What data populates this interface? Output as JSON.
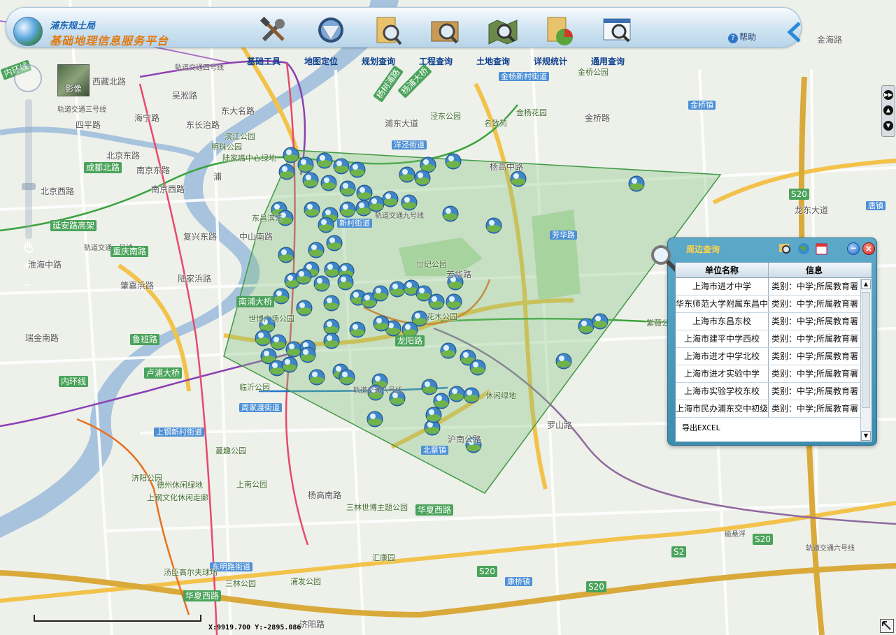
{
  "header": {
    "org_name": "浦东规土局",
    "platform_name": "基础地理信息服务平台",
    "help_label": "帮助",
    "tools": [
      {
        "label": "基础工具",
        "icon": "tools-icon"
      },
      {
        "label": "地图定位",
        "icon": "globe-locate-icon"
      },
      {
        "label": "规划查询",
        "icon": "plan-query-icon"
      },
      {
        "label": "工程查询",
        "icon": "project-query-icon"
      },
      {
        "label": "土地查询",
        "icon": "land-query-icon"
      },
      {
        "label": "详规统计",
        "icon": "pie-chart-icon"
      },
      {
        "label": "通用查询",
        "icon": "general-query-icon"
      }
    ]
  },
  "map": {
    "imagery_label": "影像",
    "labels": [
      {
        "t": "内环线",
        "c": "roadg",
        "rot": -20
      },
      {
        "t": "轨道交通四号线",
        "c": "metro"
      },
      {
        "t": "杨树浦路",
        "c": "roadg",
        "rot": -55
      },
      {
        "t": "杨浦大桥",
        "c": "roadg",
        "rot": -45
      },
      {
        "t": "金杨新村街道",
        "c": "street"
      },
      {
        "t": "金桥公园",
        "c": "poi"
      },
      {
        "t": "金桥镇",
        "c": "street"
      },
      {
        "t": "金海路",
        "c": "road"
      },
      {
        "t": "西藏北路",
        "c": "road"
      },
      {
        "t": "吴淞路",
        "c": "road"
      },
      {
        "t": "东大名路",
        "c": "road"
      },
      {
        "t": "轨道交通三号线",
        "c": "metro"
      },
      {
        "t": "四平路",
        "c": "road"
      },
      {
        "t": "海宁路",
        "c": "road"
      },
      {
        "t": "东长治路",
        "c": "road"
      },
      {
        "t": "浦东大道",
        "c": "road"
      },
      {
        "t": "泾东公园",
        "c": "poi"
      },
      {
        "t": "金杨花园",
        "c": "poi"
      },
      {
        "t": "名致苑",
        "c": "poi"
      },
      {
        "t": "杨高中路",
        "c": "road"
      },
      {
        "t": "金桥路",
        "c": "road"
      },
      {
        "t": "滨江公园",
        "c": "poi"
      },
      {
        "t": "明珠公园",
        "c": "poi"
      },
      {
        "t": "陆家嘴中心绿地",
        "c": "poi"
      },
      {
        "t": "洋泾街道",
        "c": "street"
      },
      {
        "t": "北京东路",
        "c": "road"
      },
      {
        "t": "南京东路",
        "c": "road"
      },
      {
        "t": "北京西路",
        "c": "road"
      },
      {
        "t": "成都北路",
        "c": "roadg"
      },
      {
        "t": "南京西路",
        "c": "road"
      },
      {
        "t": "浦",
        "c": "road"
      },
      {
        "t": "东昌滨江",
        "c": "poi"
      },
      {
        "t": "新村街道",
        "c": "street"
      },
      {
        "t": "轨道交通九号线",
        "c": "metro"
      },
      {
        "t": "延安路高架",
        "c": "roadg"
      },
      {
        "t": "复兴东路",
        "c": "road"
      },
      {
        "t": "中山南路",
        "c": "road"
      },
      {
        "t": "轨道交通一号线",
        "c": "metro"
      },
      {
        "t": "淮海中路",
        "c": "road"
      },
      {
        "t": "重庆南路",
        "c": "roadg"
      },
      {
        "t": "世纪公园",
        "c": "poi"
      },
      {
        "t": "芳华路",
        "c": "road"
      },
      {
        "t": "罗山路",
        "c": "road"
      },
      {
        "t": "S20",
        "c": "roadg"
      },
      {
        "t": "龙东大道",
        "c": "road"
      },
      {
        "t": "唐镇",
        "c": "street"
      },
      {
        "t": "陆家浜路",
        "c": "road"
      },
      {
        "t": "肇嘉浜路",
        "c": "road"
      },
      {
        "t": "南浦大桥",
        "c": "roadg"
      },
      {
        "t": "世博广场公园",
        "c": "poi"
      },
      {
        "t": "龙阳路",
        "c": "roadg"
      },
      {
        "t": "花木公园",
        "c": "poi"
      },
      {
        "t": "紫薇公园",
        "c": "poi"
      },
      {
        "t": "华夏东路",
        "c": "roadg"
      },
      {
        "t": "瑞金南路",
        "c": "road"
      },
      {
        "t": "鲁班路",
        "c": "roadg"
      },
      {
        "t": "内环线",
        "c": "roadg"
      },
      {
        "t": "卢浦大桥",
        "c": "roadg"
      },
      {
        "t": "临沂公园",
        "c": "poi"
      },
      {
        "t": "周家渡街道",
        "c": "street"
      },
      {
        "t": "轨道交通八号线",
        "c": "metro"
      },
      {
        "t": "休闲绿地",
        "c": "poi"
      },
      {
        "t": "上钢新村街道",
        "c": "street"
      },
      {
        "t": "蔓趣公园",
        "c": "poi"
      },
      {
        "t": "北蔡镇",
        "c": "street"
      },
      {
        "t": "沪南公路",
        "c": "road"
      },
      {
        "t": "济阳公园",
        "c": "poi"
      },
      {
        "t": "德州休闲绿地",
        "c": "poi"
      },
      {
        "t": "上钢文化休闲走廊",
        "c": "poi"
      },
      {
        "t": "上南公园",
        "c": "poi"
      },
      {
        "t": "杨高南路",
        "c": "road"
      },
      {
        "t": "三林世博主题公园",
        "c": "poi"
      },
      {
        "t": "华夏西路",
        "c": "roadg"
      },
      {
        "t": "磁悬浮",
        "c": "metro"
      },
      {
        "t": "S20",
        "c": "roadg"
      },
      {
        "t": "S2",
        "c": "roadg"
      },
      {
        "t": "轨道交通六号线",
        "c": "metro"
      },
      {
        "t": "东明路街道",
        "c": "street"
      },
      {
        "t": "三林公园",
        "c": "poi"
      },
      {
        "t": "浦发公园",
        "c": "poi"
      },
      {
        "t": "汇康园",
        "c": "poi"
      },
      {
        "t": "S20",
        "c": "roadg"
      },
      {
        "t": "康桥镇",
        "c": "street"
      },
      {
        "t": "S20",
        "c": "roadg"
      },
      {
        "t": "济阳路",
        "c": "road"
      },
      {
        "t": "华夏西路",
        "c": "roadg"
      },
      {
        "t": "汤臣高尔夫球场",
        "c": "poi"
      },
      {
        "t": "芳华路",
        "c": "street"
      }
    ]
  },
  "panel": {
    "title": "周边查询",
    "columns": [
      "单位名称",
      "信息"
    ],
    "rows": [
      [
        "上海市进才中学",
        "类别：中学;所属教育署"
      ],
      [
        "华东师范大学附属东昌中学",
        "类别：中学;所属教育署"
      ],
      [
        "上海市东昌东校",
        "类别：中学;所属教育署"
      ],
      [
        "上海市建平中学西校",
        "类别：中学;所属教育署"
      ],
      [
        "上海市进才中学北校",
        "类别：中学;所属教育署"
      ],
      [
        "上海市进才实验中学",
        "类别：中学;所属教育署"
      ],
      [
        "上海市实验学校东校",
        "类别：中学;所属教育署"
      ],
      [
        "上海市民办浦东交中初级中学",
        "类别：中学;所属教育署"
      ]
    ],
    "export_label": "导出EXCEL"
  },
  "status": {
    "coords": "X:9919.700  Y:-2895.086"
  },
  "colors": {
    "polygon_fill": "#7fbf7a",
    "polygon_stroke": "#3f9a45",
    "river": "#a7c3de",
    "panel_bg": "#4b9bbd"
  }
}
